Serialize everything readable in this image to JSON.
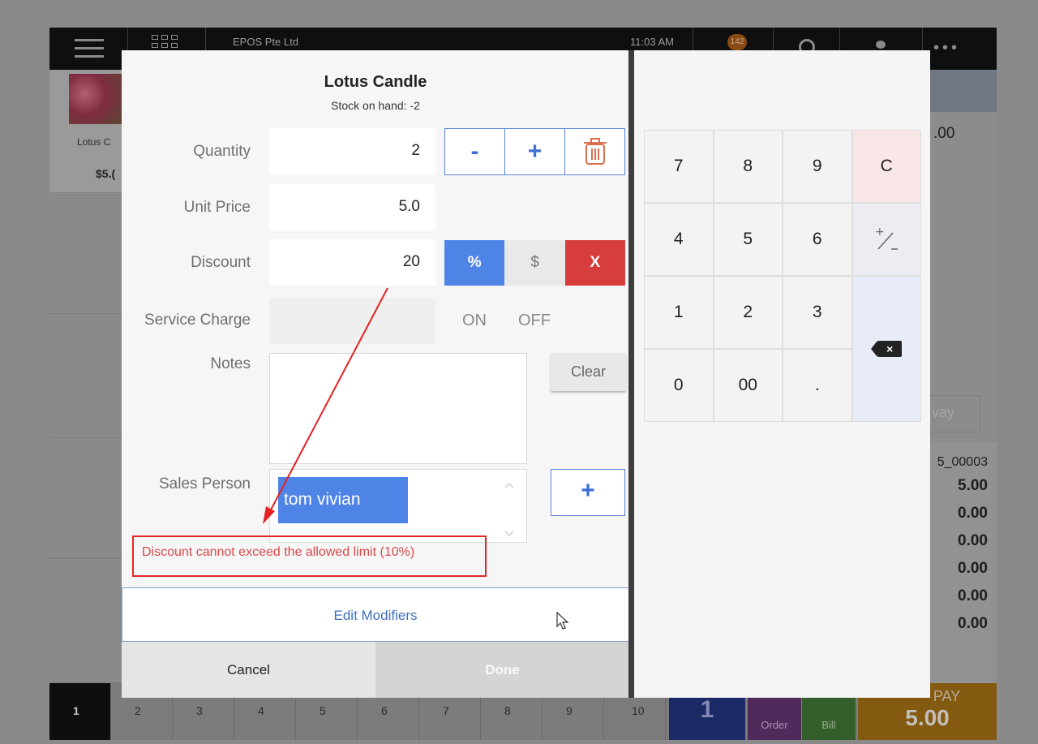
{
  "topbar": {
    "company": "EPOS Pte Ltd",
    "time": "11:03 AM",
    "notification_count": "142"
  },
  "product_tile": {
    "name": "Lotus C",
    "price": "$5.("
  },
  "order_panel": {
    "total": ".00",
    "takeaway": "vay",
    "ref": "5_00003",
    "rows": [
      "5.00",
      "0.00",
      "0.00",
      "0.00",
      "0.00",
      "0.00"
    ]
  },
  "bottom": {
    "tabs": [
      "1",
      "2",
      "3",
      "4",
      "5",
      "6",
      "7",
      "8",
      "9",
      "10"
    ],
    "count": "1",
    "order_label": "Order",
    "bill_label": "Bill",
    "pay_label": "PAY",
    "pay_amount": "5.00"
  },
  "dialog": {
    "title": "Lotus Candle",
    "stock": "Stock on hand: -2",
    "labels": {
      "quantity": "Quantity",
      "unit_price": "Unit Price",
      "discount": "Discount",
      "service_charge": "Service Charge",
      "notes": "Notes",
      "sales_person": "Sales Person"
    },
    "quantity": "2",
    "unit_price": "5.0",
    "discount": "20",
    "qty_minus": "-",
    "qty_plus": "+",
    "disc_pct": "%",
    "disc_dollar": "$",
    "disc_clear": "X",
    "svc_on": "ON",
    "svc_off": "OFF",
    "clear_label": "Clear",
    "sales_person": "tom vivian",
    "add_person": "+",
    "error": "Discount cannot exceed the allowed limit (10%)",
    "edit_modifiers": "Edit Modifiers",
    "cancel": "Cancel",
    "done": "Done"
  },
  "keypad": {
    "keys": [
      "7",
      "8",
      "9",
      "C",
      "4",
      "5",
      "6",
      "+/-",
      "1",
      "2",
      "3",
      "0",
      "00",
      "."
    ],
    "backspace": "×"
  }
}
